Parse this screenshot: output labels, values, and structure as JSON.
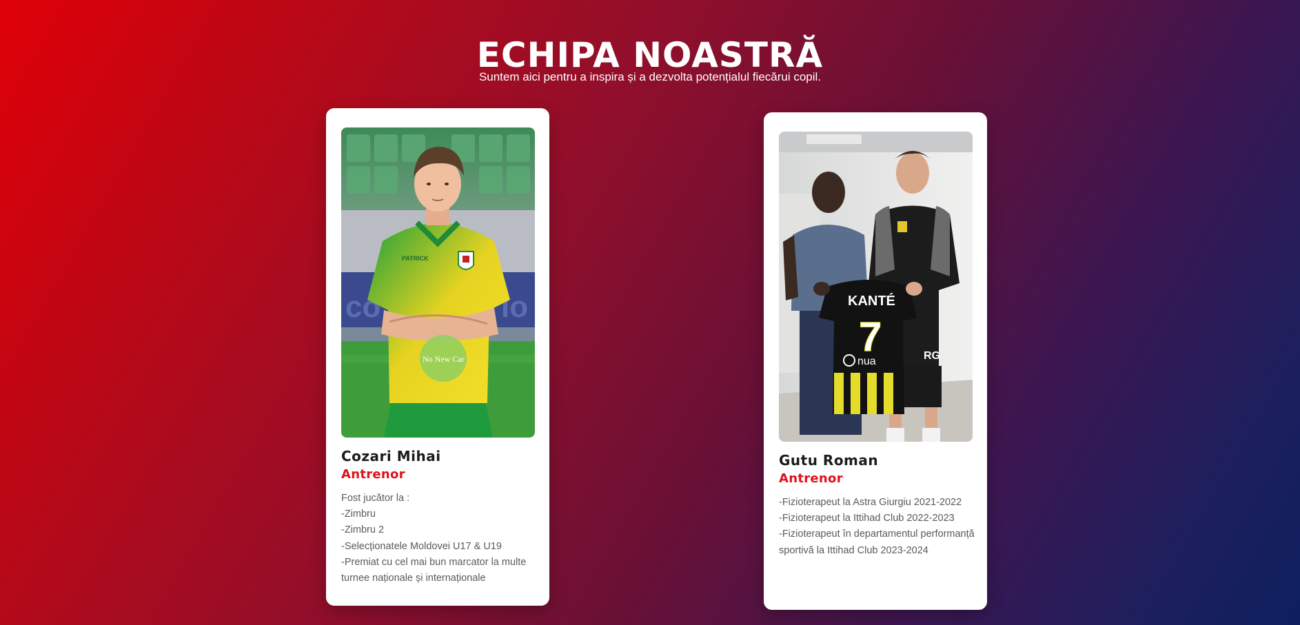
{
  "header": {
    "title": "ECHIPA NOASTRĂ",
    "subtitle": "Suntem aici pentru a inspira și a dezvolta potențialul fiecărui copil."
  },
  "team": [
    {
      "name": "Cozari Mihai",
      "role": "Antrenor",
      "bio": [
        "Fost jucător la :",
        "-Zimbru",
        "-Zimbru 2",
        "-Selecționatele Moldovei U17 & U19",
        "-Premiat cu cel mai bun marcator la multe",
        "turnee naționale și internaționale"
      ],
      "photo_text": "PATRICK"
    },
    {
      "name": "Gutu Roman",
      "role": "Antrenor",
      "bio": [
        "-Fizioterapeut la Astra Giurgiu 2021-2022",
        "-Fizioterapeut la Ittihad Club 2022-2023",
        "-Fizioterapeut în departamentul performanță",
        "sportivă la Ittihad Club 2023-2024"
      ],
      "photo_text": {
        "shirt_name": "KANTÉ",
        "shirt_number": "7",
        "sponsor": "nua",
        "shorts_initials": "RG"
      }
    }
  ],
  "colors": {
    "accent": "#e0101a",
    "card_bg": "#ffffff",
    "text": "#1b1b1b",
    "muted": "#5a5a5a"
  }
}
